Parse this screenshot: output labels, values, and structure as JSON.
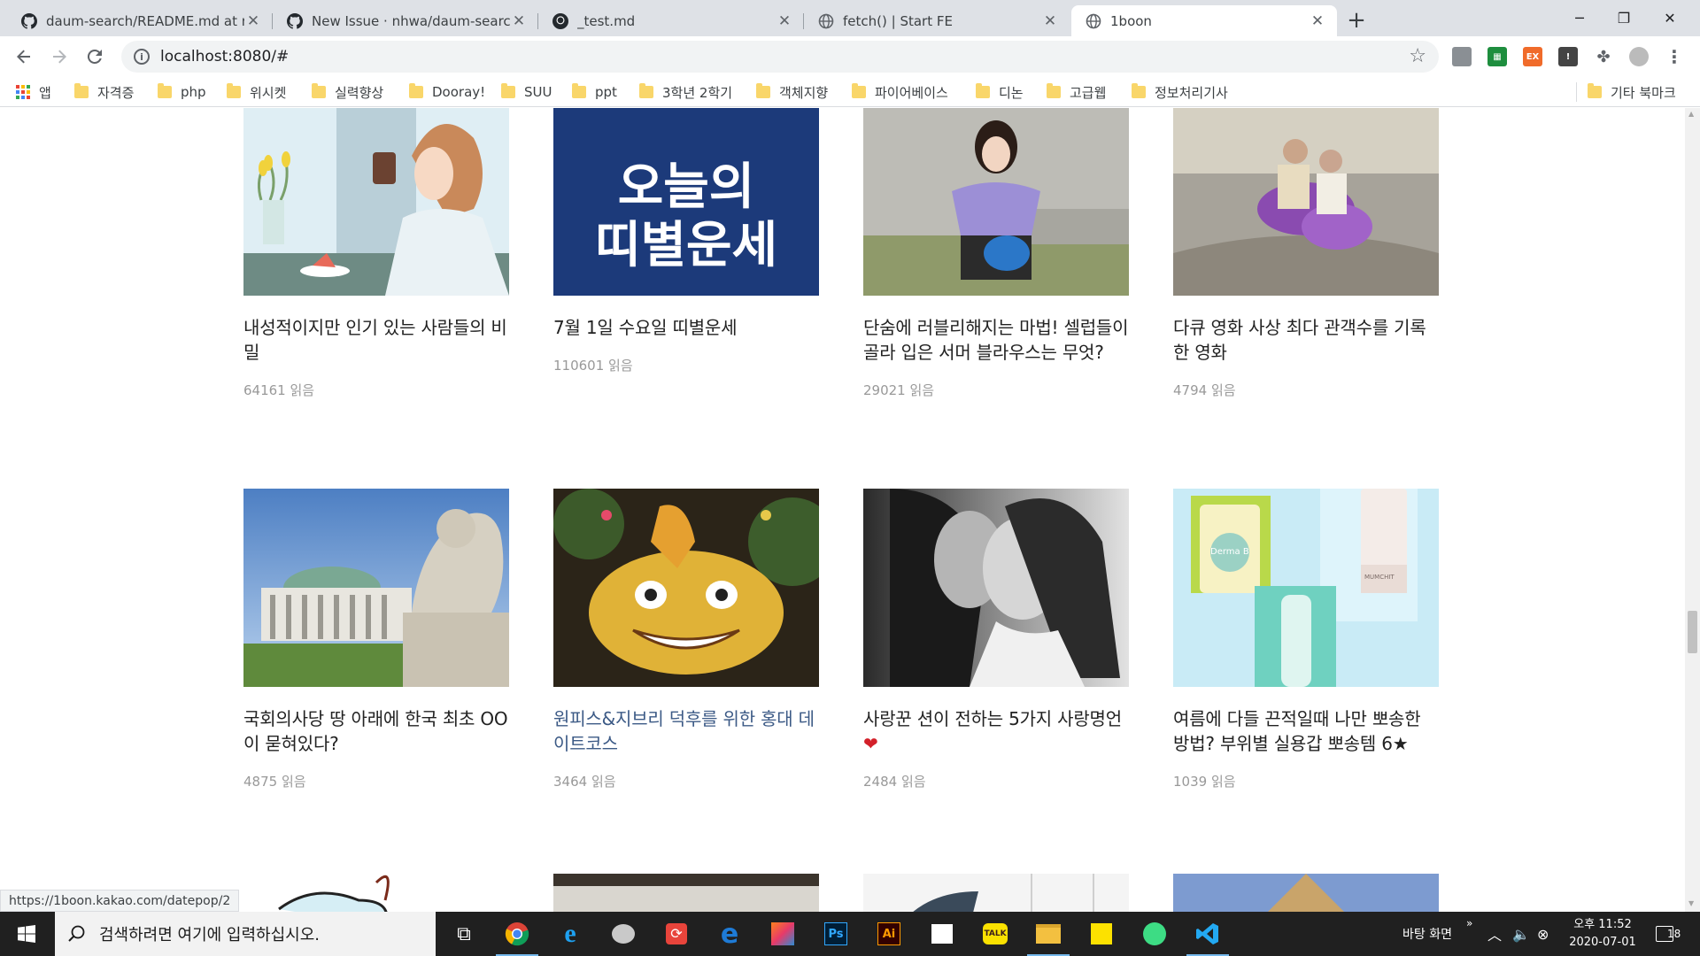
{
  "browser": {
    "tabs": [
      {
        "title": "daum-search/README.md at m",
        "active": false,
        "icon": "github-icon"
      },
      {
        "title": "New Issue · nhwa/daum-search",
        "active": false,
        "icon": "github-icon"
      },
      {
        "title": "_test.md",
        "active": false,
        "icon": "github-icon"
      },
      {
        "title": "fetch() | Start FE",
        "active": false,
        "icon": "globe-icon"
      },
      {
        "title": "1boon",
        "active": true,
        "icon": "globe-icon"
      }
    ],
    "address": "localhost:8080/#",
    "bookmarks": {
      "apps_label": "앱",
      "folders": [
        "자격증",
        "php",
        "위시켓",
        "실력향상",
        "Dooray!",
        "SUU",
        "ppt",
        "3학년 2학기",
        "객체지향",
        "파이어베이스",
        "디논",
        "고급웹",
        "정보처리기사"
      ],
      "other_label": "기타 북마크"
    },
    "extensions": [
      {
        "name": "ext-1",
        "color": "#8a8f94",
        "glyph": ""
      },
      {
        "name": "ext-sheets",
        "color": "#1e8e3e",
        "glyph": "▦"
      },
      {
        "name": "ext-ex",
        "color": "#f06b2a",
        "glyph": "EX"
      },
      {
        "name": "ext-info",
        "color": "#444",
        "glyph": "!"
      }
    ],
    "status_url": "https://1boon.kakao.com/datepop/2"
  },
  "cards_row1": [
    {
      "title": "내성적이지만 인기 있는 사람들의 비밀",
      "reads": "64161 읽음"
    },
    {
      "title": "7월 1일 수요일 띠별운세",
      "reads": "110601 읽음",
      "thumb_text": [
        "오늘의",
        "띠별운세"
      ]
    },
    {
      "title": "단숨에 러블리해지는 마법! 셀럽들이 골라 입은 서머 블라우스는 무엇?",
      "reads": "29021 읽음"
    },
    {
      "title": "다큐 영화 사상 최다 관객수를 기록한 영화",
      "reads": "4794 읽음"
    }
  ],
  "cards_row2": [
    {
      "title": "국회의사당 땅 아래에 한국 최초 OO이 묻혀있다?",
      "reads": "4875 읽음"
    },
    {
      "title": "원피스&지브리 덕후를 위한 홍대 데이트코스",
      "reads": "3464 읽음"
    },
    {
      "title": "사랑꾼 션이 전하는 5가지 사랑명언",
      "reads": "2484 읽음"
    },
    {
      "title": "여름에 다들 끈적일때 나만 뽀송한 방법? 부위별 실용갑 뽀송템 6★",
      "reads": "1039 읽음",
      "thumb_text": [
        "Derma B",
        "MUMCHIT"
      ]
    }
  ],
  "taskbar": {
    "search_placeholder": "검색하려면 여기에 입력하십시오.",
    "desktop_label": "바탕 화면",
    "time": "오후 11:52",
    "date": "2020-07-01",
    "notification_count": "18",
    "colors": {
      "accent": "#76b9ed",
      "bg": "#202020"
    }
  }
}
